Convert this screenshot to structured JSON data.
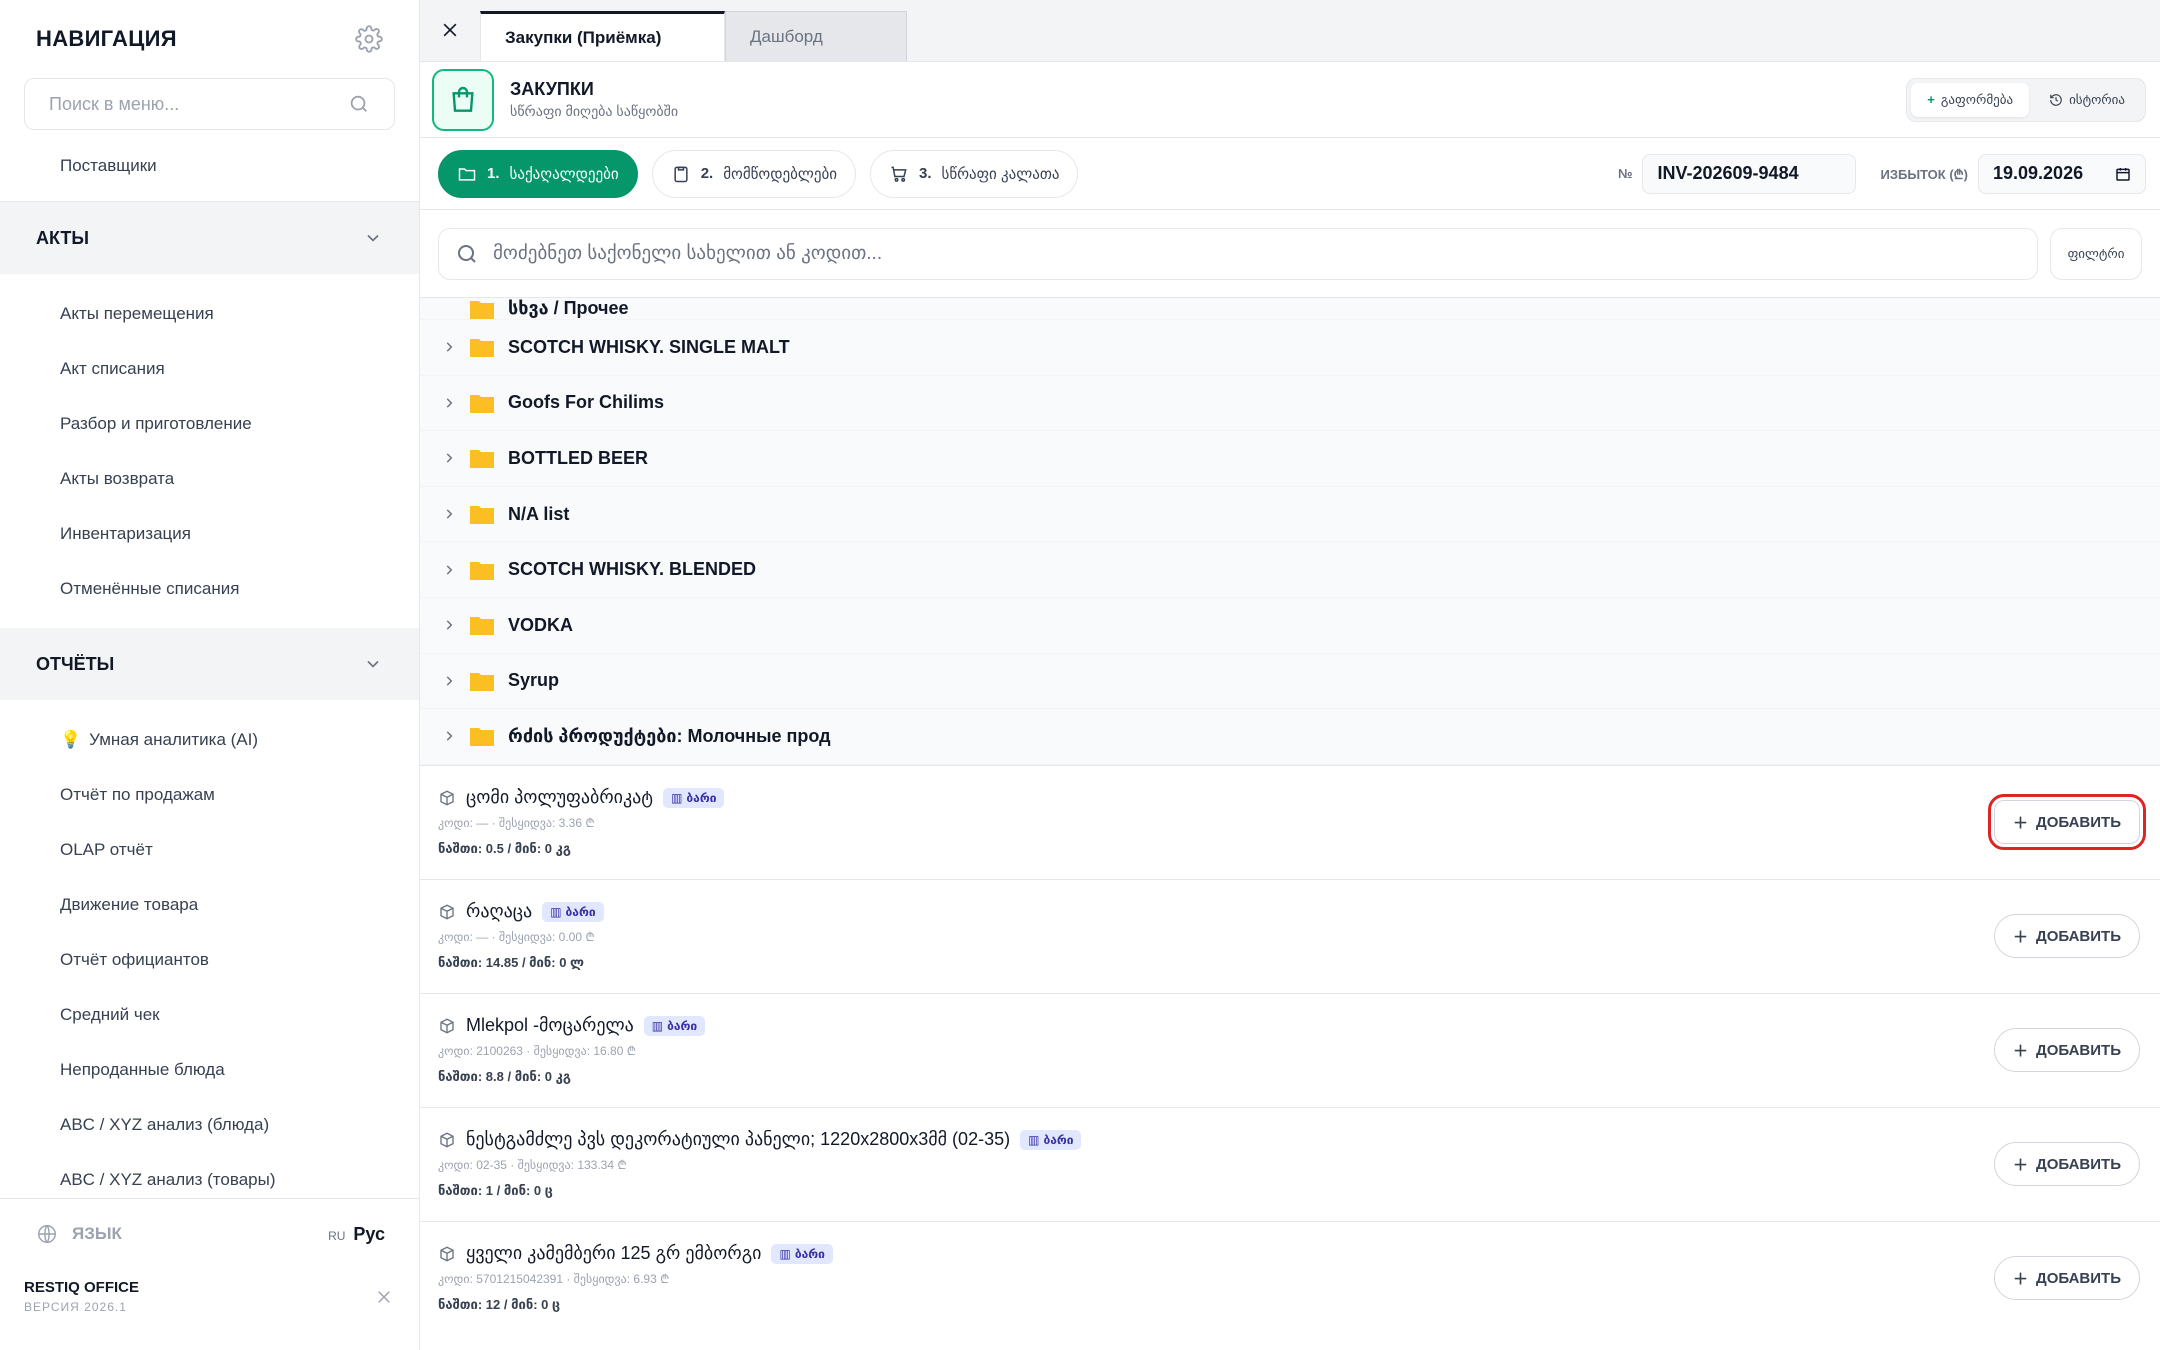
{
  "sidebar": {
    "title": "НАВИГАЦИЯ",
    "search_placeholder": "Поиск в меню...",
    "top_item": "Поставщики",
    "sections": [
      {
        "title": "АКТЫ",
        "items": [
          "Акты перемещения",
          "Акт списания",
          "Разбор и приготовление",
          "Акты возврата",
          "Инвентаризация",
          "Отменённые списания"
        ]
      },
      {
        "title": "ОТЧЁТЫ",
        "items": [
          "Умная аналитика (AI)",
          "Отчёт по продажам",
          "OLAP отчёт",
          "Движение товара",
          "Отчёт официантов",
          "Средний чек",
          "Непроданные блюда",
          "ABC / XYZ анализ (блюда)",
          "ABC / XYZ анализ (товары)"
        ]
      }
    ],
    "language_label": "ЯЗЫК",
    "language_code": "RU",
    "language_value": "Рус",
    "brand": "RESTIQ OFFICE",
    "version": "ВЕРСИЯ 2026.1"
  },
  "tabs": [
    {
      "label": "Закупки (Приёмка)",
      "active": true
    },
    {
      "label": "Дашборд",
      "active": false
    }
  ],
  "header": {
    "title": "ЗАКУПКИ",
    "subtitle": "სწრაფი მიღება საწყობში",
    "btn_new": "გაფორმება",
    "btn_history": "ისტორია"
  },
  "steps": [
    {
      "num": "1.",
      "label": "საქაღალდეები",
      "icon": "folder-icon",
      "active": true
    },
    {
      "num": "2.",
      "label": "მომწოდებლები",
      "icon": "clipboard-icon",
      "active": false
    },
    {
      "num": "3.",
      "label": "სწრაფი კალათა",
      "icon": "cart-icon",
      "active": false
    }
  ],
  "doc": {
    "number_label": "№",
    "number_value": "INV-202609-9484",
    "stock_label": "ИЗБЫТОК (₾)",
    "date_value": "19.09.2026"
  },
  "search": {
    "placeholder": "მოძებნეთ საქონელი სახელით ან კოდით...",
    "filter_label": "ფილტრი"
  },
  "categories": {
    "clipped": "სხვა / Прочее",
    "items": [
      "SCOTCH WHISKY. SINGLE MALT",
      "Goofs For Chilims",
      "BOTTLED BEER",
      "N/A list",
      "SCOTCH WHISKY. BLENDED",
      "VODKA",
      "Syrup",
      "რძის პროდუქტები: Молочные прод"
    ]
  },
  "products": [
    {
      "name": "ცომი პოლუფაბრიკატ",
      "badge": "ბარი",
      "meta": "კოდი: — · შესყიდვა: 3.36 ₾",
      "stock": "ნაშთი: 0.5 / მინ: 0 კგ",
      "add": "ДОБАВИТЬ"
    },
    {
      "name": "რაღაცა",
      "badge": "ბარი",
      "meta": "კოდი: — · შესყიდვა: 0.00 ₾",
      "stock": "ნაშთი: 14.85 / მინ: 0 ლ",
      "add": "ДОБАВИТЬ"
    },
    {
      "name": "Mlekpol -მოცარელა",
      "badge": "ბარი",
      "meta": "კოდი: 2100263 · შესყიდვა: 16.80 ₾",
      "stock": "ნაშთი: 8.8 / მინ: 0 კგ",
      "add": "ДОБАВИТЬ"
    },
    {
      "name": "ნესტგამძლე პვს დეკორატიული პანელი; 1220x2800x3მმ (02-35)",
      "badge": "ბარი",
      "meta": "კოდი: 02-35 · შესყიდვა: 133.34 ₾",
      "stock": "ნაშთი: 1 / მინ: 0 ც",
      "add": "ДОБАВИТЬ"
    },
    {
      "name": "ყველი კამემბერი 125 გრ ემბორგი",
      "badge": "ბარი",
      "meta": "კოდი: 5701215042391 · შესყიდვა: 6.93 ₾",
      "stock": "ნაშთი: 12 / მინ: 0 ც",
      "add": "ДОБАВИТЬ"
    }
  ],
  "colors": {
    "accent": "#059669",
    "highlight": "#dc2626",
    "folder": "#fbbf24",
    "badge_bg": "#e0e7ff"
  }
}
